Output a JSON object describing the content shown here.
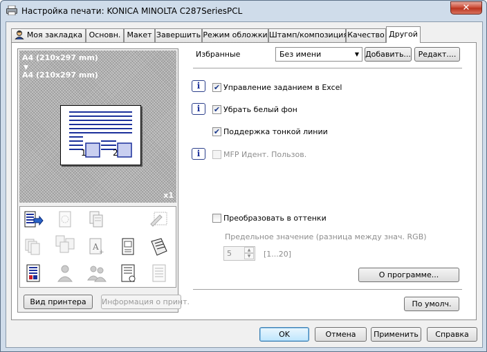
{
  "window": {
    "title": "Настройка печати: KONICA MINOLTA C287SeriesPCL",
    "close_label": "✕"
  },
  "tabs": [
    {
      "label": "Моя закладка"
    },
    {
      "label": "Основн."
    },
    {
      "label": "Макет"
    },
    {
      "label": "Завершить"
    },
    {
      "label": "Режим обложки"
    },
    {
      "label": "Штамп/композиция"
    },
    {
      "label": "Качество"
    },
    {
      "label": "Другой",
      "active": true
    }
  ],
  "preview": {
    "paper_from": "A4 (210x297 mm)",
    "paper_arrow": "▼",
    "paper_to": "A4 (210x297 mm)",
    "copies": "x1",
    "page_numbers": [
      "1",
      "2"
    ]
  },
  "function_icons": [
    "print-job-icon",
    "watermark-icon",
    "copy-pages-icon",
    "",
    "edit-stamp-icon",
    "stack-pages-icon",
    "collate-pages-icon",
    "font-page-icon",
    "document-icon",
    "booklet-icon",
    "color-document-icon",
    "user-print-icon",
    "multi-user-icon",
    "detailed-document-icon",
    "list-document-icon"
  ],
  "left_buttons": {
    "printer_view": "Вид принтера",
    "printer_info": "Информация о принт."
  },
  "favorites": {
    "label": "Избранные",
    "value": "Без имени",
    "add": "Добавить...",
    "edit": "Редакт...."
  },
  "options": [
    {
      "label": "Управление заданием в Excel",
      "checked": true,
      "info": true,
      "enabled": true
    },
    {
      "label": "Убрать белый фон",
      "checked": true,
      "info": true,
      "enabled": true
    },
    {
      "label": "Поддержка тонкой линии",
      "checked": true,
      "info": false,
      "enabled": true
    },
    {
      "label": "MFP Идент. Пользов.",
      "checked": false,
      "info": true,
      "enabled": false
    }
  ],
  "grayscale": {
    "label": "Преобразовать в оттенки",
    "checked": false,
    "threshold_label": "Предельное значение (разница между знач. RGB)",
    "value": "5",
    "range": "[1...20]"
  },
  "buttons": {
    "about": "О программе...",
    "defaults": "По умолч.",
    "ok": "OK",
    "cancel": "Отмена",
    "apply": "Применить",
    "help": "Справка"
  },
  "check_mark": "✔"
}
